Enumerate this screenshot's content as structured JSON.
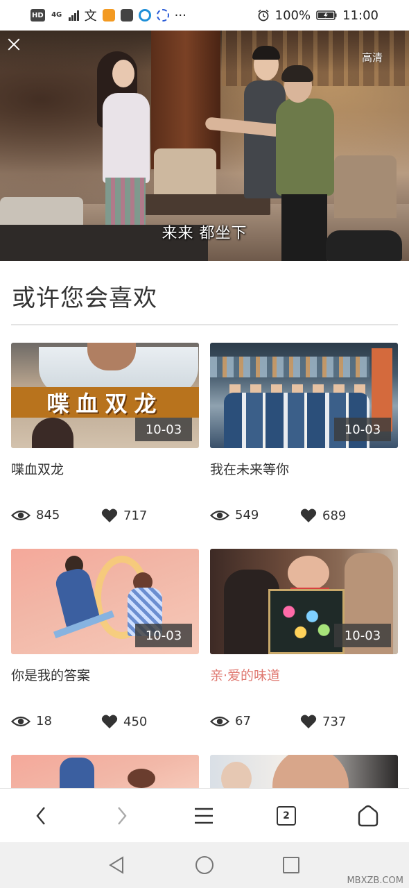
{
  "status_bar": {
    "hd": "HD",
    "network": "4G",
    "input_method": "文",
    "more": "···",
    "battery_percent": "100%",
    "time": "11:00",
    "icons": [
      "hd-icon",
      "signal-icon",
      "input-method-icon",
      "video-app-icon",
      "app-icon",
      "browser-app-icon",
      "baidu-app-icon",
      "alarm-icon",
      "battery-icon"
    ]
  },
  "video": {
    "subtitle": "来来 都坐下",
    "quality": "高清"
  },
  "section": {
    "title": "或许您会喜欢"
  },
  "cards": [
    {
      "title": "喋血双龙",
      "date": "10-03",
      "views": "845",
      "likes": "717",
      "thumb_text": "喋血双龙",
      "active": false
    },
    {
      "title": "我在未来等你",
      "date": "10-03",
      "views": "549",
      "likes": "689",
      "active": false
    },
    {
      "title": "你是我的答案",
      "date": "10-03",
      "views": "18",
      "likes": "450",
      "active": false
    },
    {
      "title": "亲·爱的味道",
      "date": "10-03",
      "views": "67",
      "likes": "737",
      "active": true
    }
  ],
  "toolbar": {
    "tab_count": "2"
  },
  "watermark": "MBXZB.COM",
  "colors": {
    "active_title": "#e07a72",
    "badge_bg": "#3c3c3c"
  }
}
